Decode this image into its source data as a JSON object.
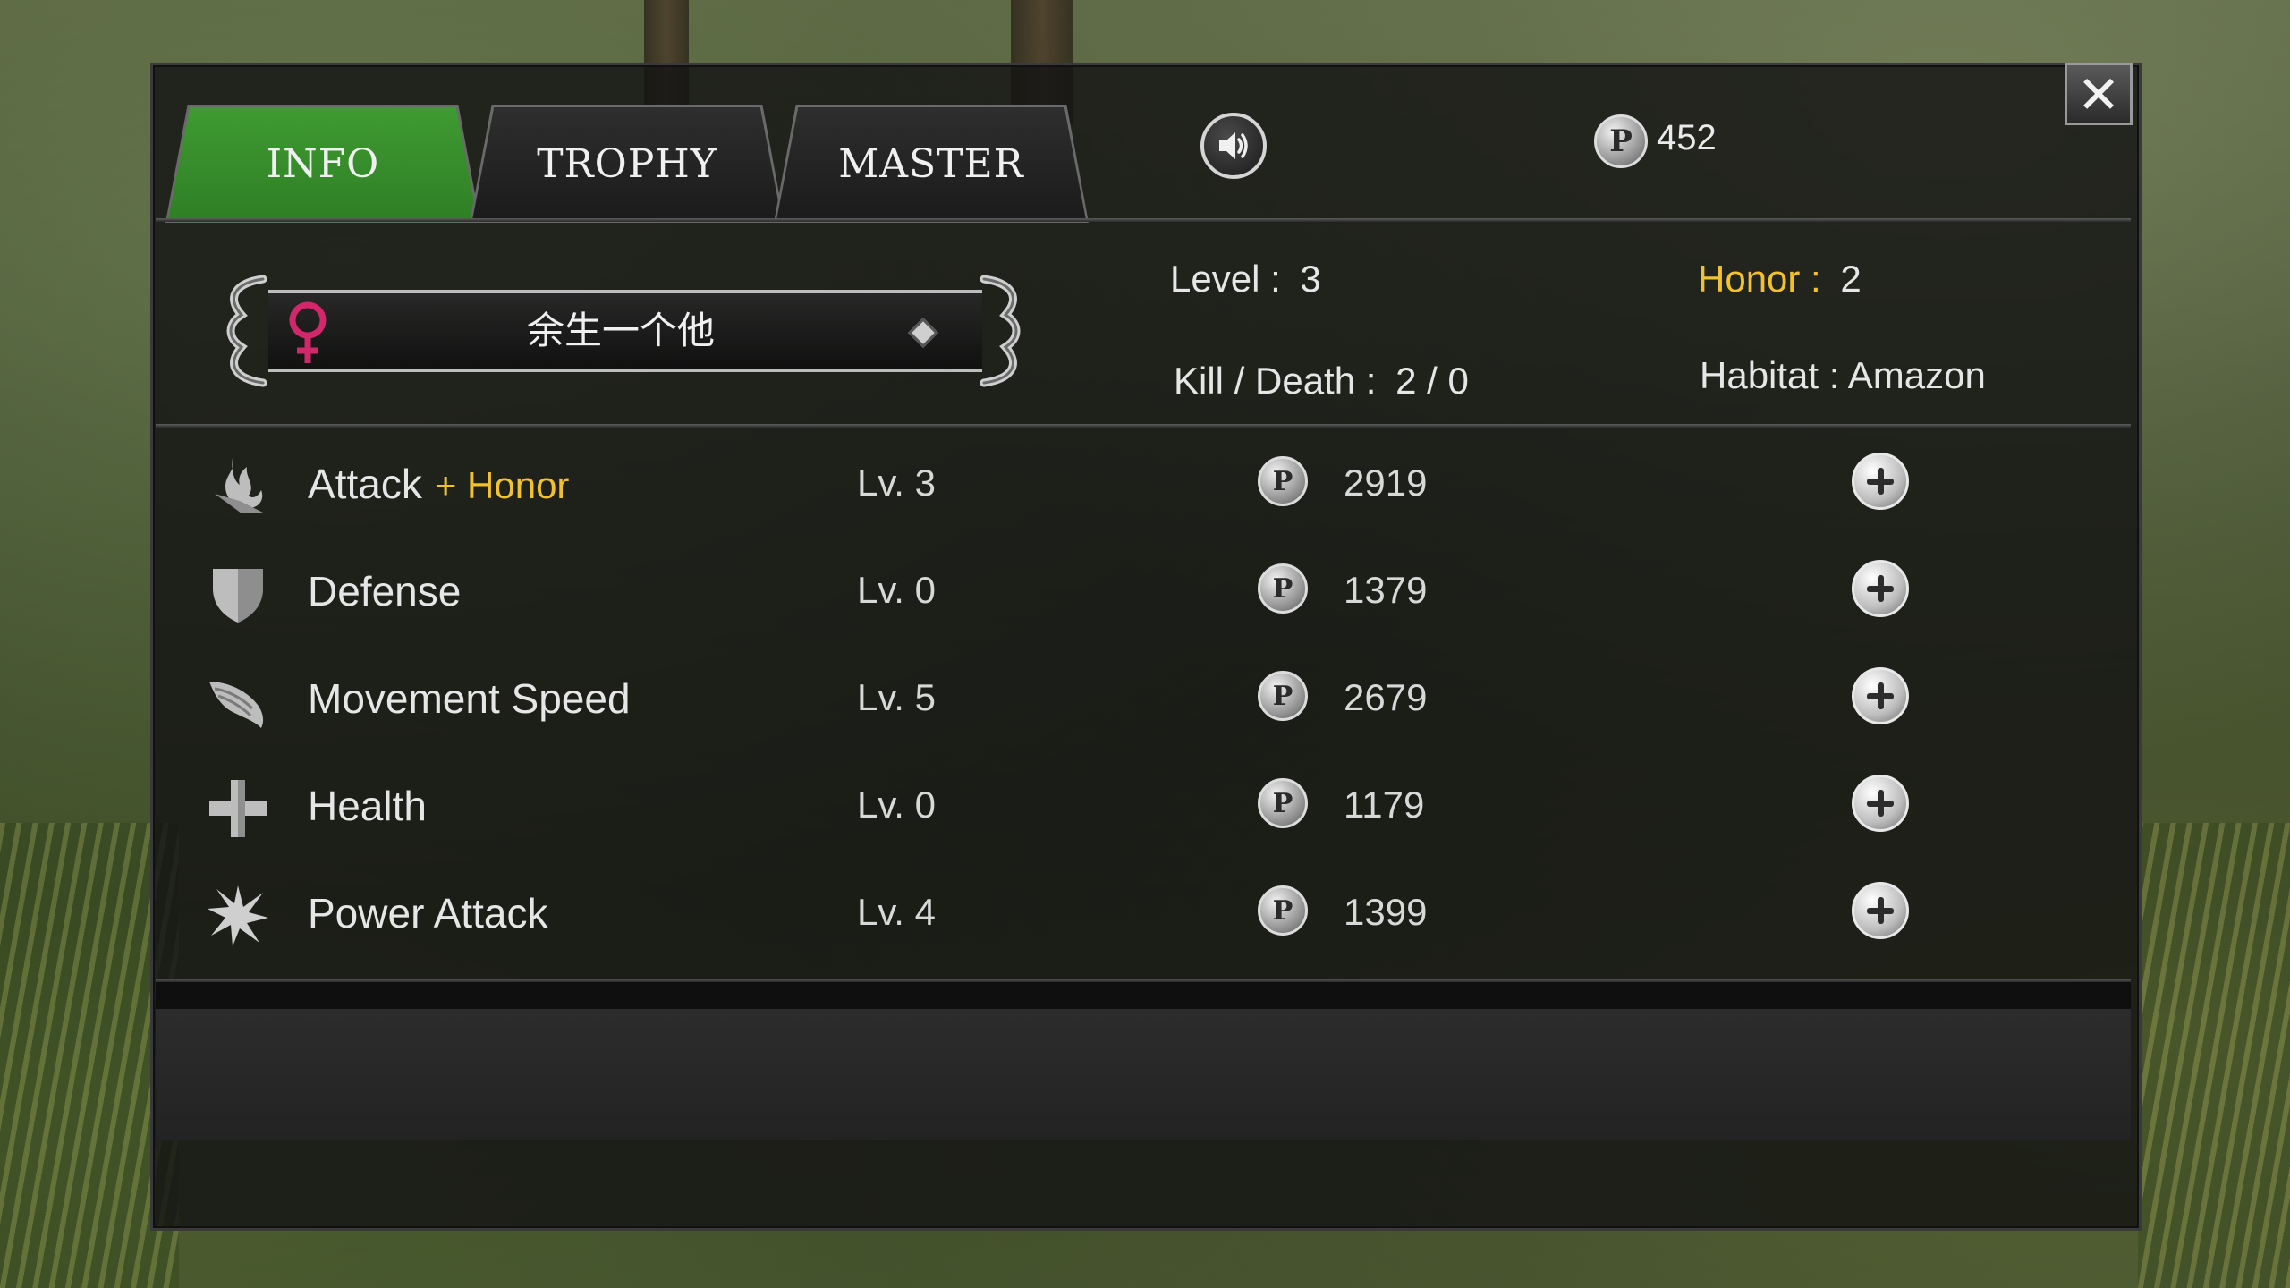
{
  "tabs": [
    {
      "label": "INFO",
      "active": true
    },
    {
      "label": "TROPHY",
      "active": false
    },
    {
      "label": "MASTER",
      "active": false
    }
  ],
  "points_balance": "452",
  "sound_icon": "speaker-icon",
  "profile": {
    "name": "余生一个他",
    "gender_icon": "female-icon",
    "level_label": "Level :",
    "level_value": "3",
    "honor_label": "Honor :",
    "honor_value": "2",
    "kd_label": "Kill / Death :",
    "kd_value": "2 / 0",
    "habitat_label": "Habitat :",
    "habitat_value": "Amazon"
  },
  "stats": [
    {
      "name": "Attack",
      "suffix": "+ Honor",
      "level": "Lv. 3",
      "cost": "2919",
      "icon": "flame-icon"
    },
    {
      "name": "Defense",
      "suffix": "",
      "level": "Lv. 0",
      "cost": "1379",
      "icon": "shield-icon"
    },
    {
      "name": "Movement Speed",
      "suffix": "",
      "level": "Lv. 5",
      "cost": "2679",
      "icon": "wing-icon"
    },
    {
      "name": "Health",
      "suffix": "",
      "level": "Lv. 0",
      "cost": "1179",
      "icon": "cross-icon"
    },
    {
      "name": "Power Attack",
      "suffix": "",
      "level": "Lv. 4",
      "cost": "1399",
      "icon": "burst-icon"
    }
  ],
  "coin_letter": "P",
  "close_label": "✕",
  "colors": {
    "active_tab": "#3f9b32",
    "honor_gold": "#f2c12e",
    "female_pink": "#d0286a"
  }
}
